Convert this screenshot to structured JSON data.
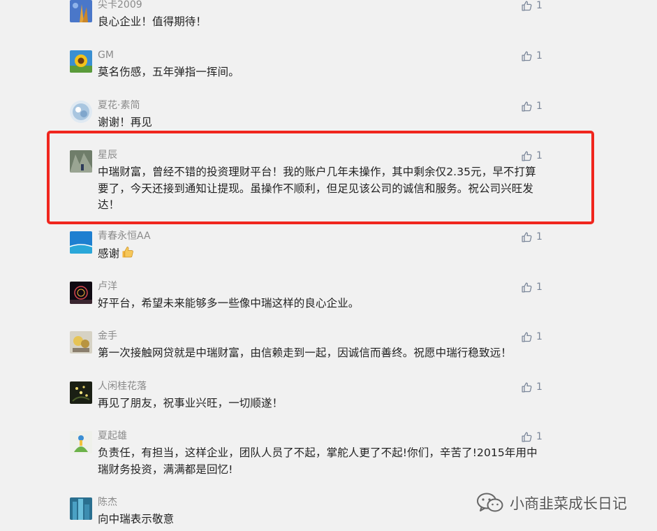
{
  "comments": [
    {
      "name": "尖卡2009",
      "text": "良心企业！值得期待！",
      "likes": "1"
    },
    {
      "name": "GM",
      "text": "莫名伤感，五年弹指一挥间。",
      "likes": "1"
    },
    {
      "name": "夏花·素简",
      "text": "谢谢！再见",
      "likes": "1"
    },
    {
      "name": "星辰",
      "text": "中瑞财富，曾经不错的投资理财平台！我的账户几年未操作，其中剩余仅2.35元，早不打算要了，今天还接到通知让提现。虽操作不顺利，但足见该公司的诚信和服务。祝公司兴旺发达！",
      "likes": "1"
    },
    {
      "name": "青春永恒AA",
      "text": "感谢",
      "likes": "1"
    },
    {
      "name": "卢洋",
      "text": "好平台，希望未来能够多一些像中瑞这样的良心企业。",
      "likes": "1"
    },
    {
      "name": "金手",
      "text": "第一次接触网贷就是中瑞财富，由信赖走到一起，因诚信而善终。祝愿中瑞行稳致远！",
      "likes": "1"
    },
    {
      "name": "人闲桂花落",
      "text": "再见了朋友，祝事业兴旺，一切顺遂！",
      "likes": "1"
    },
    {
      "name": "夏起雄",
      "text": "负责任，有担当，这样企业，团队人员了不起，掌舵人更了不起!你们，辛苦了!2015年用中瑞财务投资，满满都是回忆!",
      "likes": "1"
    },
    {
      "name": "陈杰",
      "text": "向中瑞表示敬意",
      "likes": ""
    }
  ],
  "watermark": "小商韭菜成长日记",
  "colors": {
    "highlight": "#f0261e",
    "background": "#f1f1f1",
    "nickname": "#8a8a8a",
    "like": "#7a8699"
  }
}
